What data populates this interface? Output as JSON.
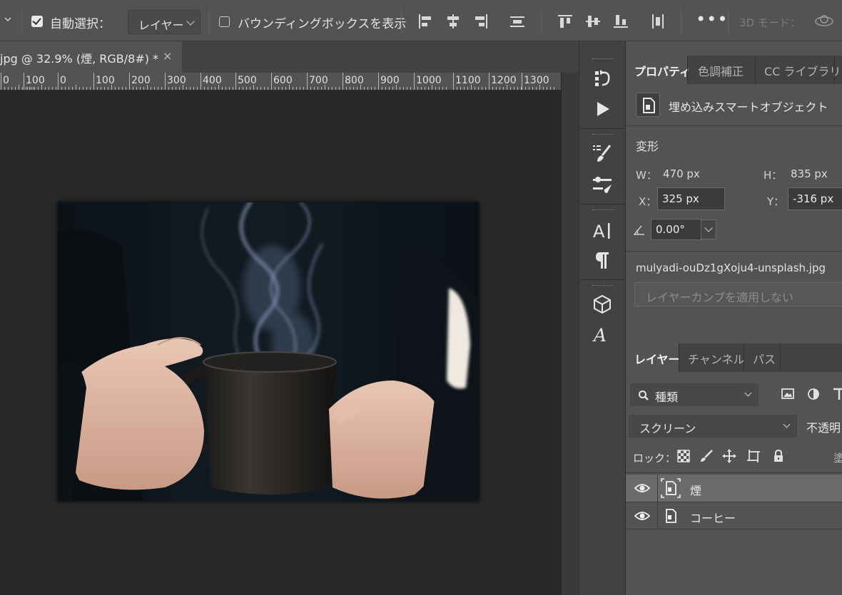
{
  "options_bar": {
    "auto_select_label": "自動選択：",
    "auto_select_target": "レイヤー",
    "show_bbox_label": "バウンディングボックスを表示",
    "more_label": "•••",
    "mode_3d_label": "3D モード："
  },
  "document": {
    "tab_title": "jpg @ 32.9% (煙, RGB/8#) *",
    "tab_close": "×",
    "ruler_ticks": [
      "0",
      "100",
      "0",
      "100",
      "200",
      "300",
      "400",
      "500",
      "600",
      "700",
      "800",
      "900",
      "1000",
      "1100",
      "1200",
      "1300"
    ]
  },
  "toolstrip": {
    "collapse_label": "«"
  },
  "properties_panel": {
    "tabs": [
      "プロパティ",
      "色調補正",
      "CC ライブラリ"
    ],
    "active_tab": 0,
    "object_type": "埋め込みスマートオブジェクト",
    "transform_title": "変形",
    "w_label": "W：",
    "w_value": "470 px",
    "h_label": "H：",
    "h_value": "835 px",
    "x_label": "X：",
    "x_value": "325 px",
    "y_label": "Y：",
    "y_value": "-316 px",
    "angle_value": "0.00°",
    "filename": "mulyadi-ouDz1gXoju4-unsplash.jpg",
    "layer_comp_placeholder": "レイヤーカンプを適用しない"
  },
  "layers_panel": {
    "tabs": [
      "レイヤー",
      "チャンネル",
      "パス"
    ],
    "active_tab": 0,
    "filter_kind": "種類",
    "blend_mode": "スクリーン",
    "opacity_label": "不透明",
    "lock_label": "ロック：",
    "fill_label": "塗",
    "layers": [
      {
        "name": "煙",
        "visible": true,
        "selected": true
      },
      {
        "name": "コーヒー",
        "visible": true,
        "selected": false
      }
    ]
  },
  "colors": {
    "panel_bg": "#535353",
    "dark_bg": "#282828",
    "tab_bg": "#424242",
    "selected_layer": "#6a6a6a"
  }
}
